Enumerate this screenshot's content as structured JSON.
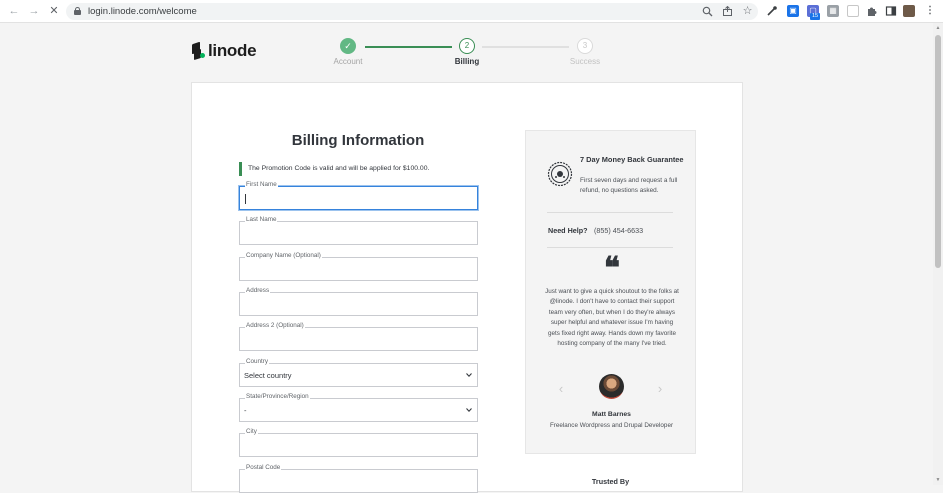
{
  "browser": {
    "url": "login.linode.com/welcome",
    "extension_badge": "15",
    "icons": [
      "back-icon",
      "forward-icon",
      "stop-loading-icon",
      "lock-icon",
      "zoom-icon",
      "share-icon",
      "bookmark-star-icon",
      "eyedropper-icon",
      "extension-icon",
      "puzzle-icon",
      "side-panel-icon",
      "profile-avatar-icon",
      "more-menu-icon"
    ]
  },
  "header": {
    "logo_text": "linode",
    "steps": [
      {
        "label": "Account",
        "marker": "✓",
        "state": "done"
      },
      {
        "label": "Billing",
        "marker": "2",
        "state": "active"
      },
      {
        "label": "Success",
        "marker": "3",
        "state": "todo"
      }
    ]
  },
  "form": {
    "title": "Billing Information",
    "promo_message": "The Promotion Code is valid and will be applied for $100.00.",
    "fields": [
      {
        "label": "First Name",
        "value": ""
      },
      {
        "label": "Last Name",
        "value": ""
      },
      {
        "label": "Company Name (Optional)",
        "value": ""
      },
      {
        "label": "Address",
        "value": ""
      },
      {
        "label": "Address 2 (Optional)",
        "value": ""
      },
      {
        "label": "Country",
        "value": "Select country"
      },
      {
        "label": "State/Province/Region",
        "value": "-"
      },
      {
        "label": "City",
        "value": ""
      },
      {
        "label": "Postal Code",
        "value": ""
      }
    ]
  },
  "sidebar": {
    "guarantee_title": "7 Day Money Back Guarantee",
    "guarantee_text": "First seven days and request a full refund, no questions asked.",
    "help_label": "Need Help?",
    "help_phone": "(855) 454-6633",
    "quote_mark": "❝",
    "testimonial": "Just want to give a quick shoutout to the folks at @linode. I don't have to contact their support team very often, but when I do they're always super helpful and whatever issue I'm having gets fixed right away. Hands down my favorite hosting company of the many I've tried.",
    "person_name": "Matt Barnes",
    "person_role": "Freelance Wordpress and Drupal Developer",
    "prev_arrow": "‹",
    "next_arrow": "›"
  },
  "trusted_by": "Trusted By",
  "colors": {
    "brand_green": "#02b159",
    "step_green": "#3a8e55",
    "focus_blue": "#3683dc",
    "page_bg": "#f4f4f4"
  }
}
